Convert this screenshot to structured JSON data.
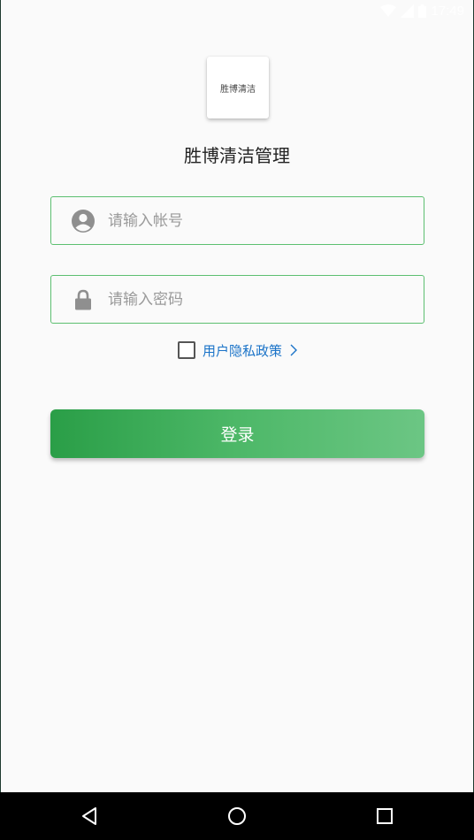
{
  "status_bar": {
    "time": "17:49",
    "icons": [
      "wifi-icon",
      "signal-icon",
      "battery-icon"
    ]
  },
  "logo": {
    "text": "胜博清洁"
  },
  "app": {
    "title": "胜博清洁管理"
  },
  "username": {
    "placeholder": "请输入帐号",
    "value": "",
    "icon": "account-circle-icon"
  },
  "password": {
    "placeholder": "请输入密码",
    "value": "",
    "icon": "lock-icon"
  },
  "privacy": {
    "checked": false,
    "label": "用户隐私政策",
    "icon": "chevron-right-icon"
  },
  "login": {
    "label": "登录"
  },
  "colors": {
    "accent": "#4db868",
    "link": "#1a73c8",
    "field_border": "#5cbf70"
  },
  "nav_bar": {
    "buttons": [
      "back-icon",
      "home-icon",
      "recents-icon"
    ]
  }
}
